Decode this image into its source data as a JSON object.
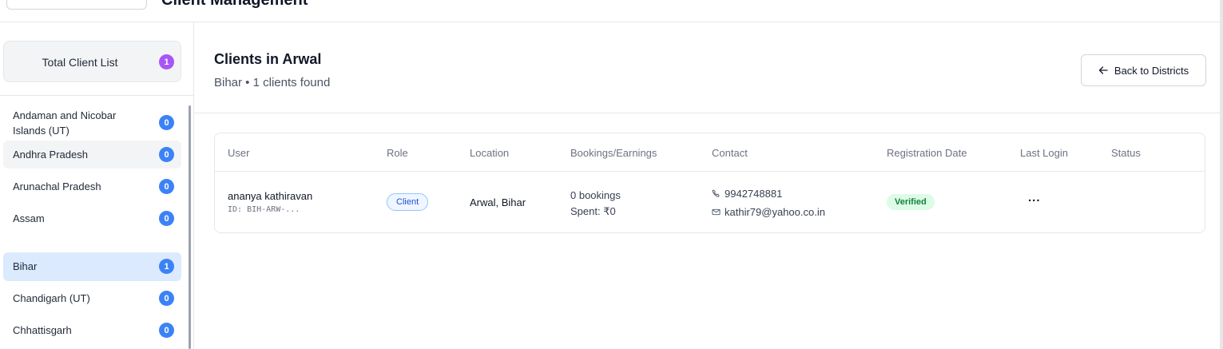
{
  "header": {
    "title": "Client Management"
  },
  "sidebar": {
    "total_label": "Total Client List",
    "total_count": "1",
    "items": [
      {
        "label": "Andaman and Nicobar Islands (UT)",
        "count": "0"
      },
      {
        "label": "Andhra Pradesh",
        "count": "0"
      },
      {
        "label": "Arunachal Pradesh",
        "count": "0"
      },
      {
        "label": "Assam",
        "count": "0"
      },
      {
        "label": "Bihar",
        "count": "1"
      },
      {
        "label": "Chandigarh (UT)",
        "count": "0"
      },
      {
        "label": "Chhattisgarh",
        "count": "0"
      }
    ]
  },
  "main": {
    "title": "Clients in Arwal",
    "subtitle": "Bihar • 1 clients found",
    "back_label": "Back to Districts",
    "table": {
      "columns": [
        "User",
        "Role",
        "Location",
        "Bookings/Earnings",
        "Contact",
        "Registration Date",
        "Last Login",
        "Status"
      ],
      "rows": [
        {
          "name": "ananya kathiravan",
          "id": "ID: BIH-ARW-...",
          "role": "Client",
          "location": "Arwal, Bihar",
          "bookings": "0 bookings",
          "spent": "Spent: ₹0",
          "phone": "9942748881",
          "email": "kathir79@yahoo.co.in",
          "registration": "Verified",
          "last_login": "..."
        }
      ]
    }
  },
  "colors": {
    "accent_blue": "#3b82f6",
    "accent_purple": "#a855f7",
    "verified_bg": "#dcfce7",
    "verified_text": "#15803d",
    "active_row": "#dbeafe"
  }
}
